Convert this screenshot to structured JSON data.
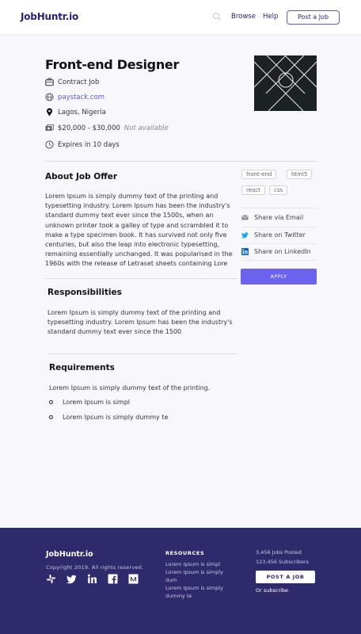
{
  "header": {
    "logo": "JobHuntr.io",
    "nav": {
      "browse": "Browse",
      "help": "Help"
    },
    "post_job": "Post a Job"
  },
  "job": {
    "title": "Front-end Designer",
    "type": "Contract Job",
    "website": "paystack.com",
    "location": "Lagos, Nigeria",
    "salary": "$20,000 - $30,000",
    "salary_note": "Not available",
    "expires": "Expires in 10 days"
  },
  "about": {
    "heading": "About Job Offer",
    "lines": [
      "Lorem Ipsum is simply dummy text of the printing and",
      "typesetting industry. Lorem Ipsum has been the industry's",
      "standard dummy text ever since the 1500s, when an",
      "unknown printer took a galley of type and scrambled it to",
      "make a type specimen book. It has survived not only five",
      "centuries, but also the leap into electronic typesetting,",
      "remaining essentially unchanged. It was popularised in the",
      "1960s with the release of Letraset sheets containing Lore"
    ]
  },
  "tags": [
    "front-end",
    "html5",
    "react",
    "css"
  ],
  "share": {
    "email": "Share via Email",
    "twitter": "Share on Twitter",
    "linkedin": "Share on LinkedIn"
  },
  "apply": "APPLY",
  "responsibilities": {
    "heading": "Responsibilities",
    "lines": [
      "Lorem Ipsum is simply dummy text of the printing and",
      "typesetting industry. Lorem Ipsum has been the industry's",
      "standard dummy text ever since the 1500"
    ]
  },
  "requirements": {
    "heading": "Requirements",
    "intro": "Lorem Ipsum is simply dummy text of the printing.",
    "items": [
      "Lorem Ipsum is simpl",
      "Lorem Ipsum is simply dummy te"
    ]
  },
  "footer": {
    "logo": "JobHuntr.io",
    "copyright": "Copyright 2019. All rights reserved.",
    "social_icons": [
      "slack-icon",
      "twitter-icon",
      "linkedin-icon",
      "facebook-icon",
      "medium-icon"
    ],
    "resources_heading": "RESOURCES",
    "resources": [
      {
        "lines": [
          "Lorem Ipsum is simpl"
        ]
      },
      {
        "lines": [
          "Lorem Ipsum is simply",
          "dum"
        ]
      },
      {
        "lines": [
          "Lorem Ipsum is simply",
          "dummy te"
        ]
      }
    ],
    "jobs_posted": "3,456 Jobs Posted",
    "subscribers": "123,456 Subscribers",
    "post_job": "POST A JOB",
    "subscribe": "Or subscribe"
  },
  "colors": {
    "brand": "#2b1e77",
    "accent": "#6b63ee",
    "footer_bg": "#2f2a6b"
  }
}
